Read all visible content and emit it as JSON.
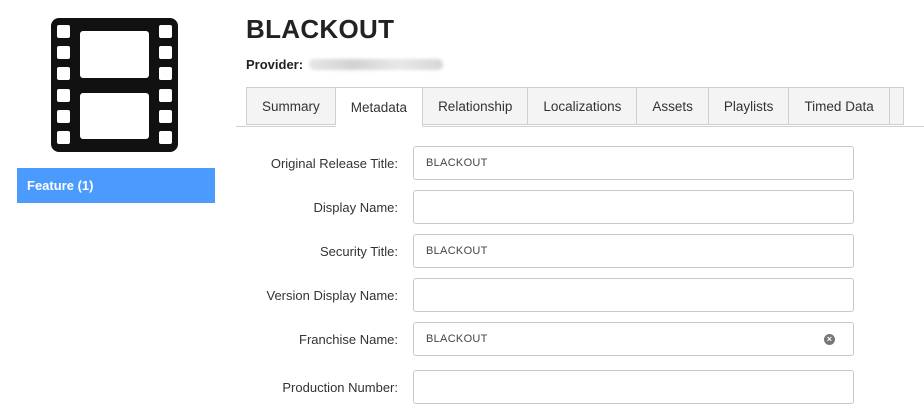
{
  "sidebar": {
    "items": [
      {
        "label": "Feature (1)"
      }
    ]
  },
  "header": {
    "title": "BLACKOUT",
    "provider_label": "Provider:"
  },
  "tabs": [
    {
      "label": "Summary",
      "active": false
    },
    {
      "label": "Metadata",
      "active": true
    },
    {
      "label": "Relationship",
      "active": false
    },
    {
      "label": "Localizations",
      "active": false
    },
    {
      "label": "Assets",
      "active": false
    },
    {
      "label": "Playlists",
      "active": false
    },
    {
      "label": "Timed Data",
      "active": false
    }
  ],
  "form": {
    "fields": [
      {
        "label": "Original Release Title:",
        "value": "BLACKOUT"
      },
      {
        "label": "Display Name:",
        "value": ""
      },
      {
        "label": "Security Title:",
        "value": "BLACKOUT"
      },
      {
        "label": "Version Display Name:",
        "value": ""
      },
      {
        "label": "Franchise Name:",
        "value": "BLACKOUT",
        "clearable": true
      },
      {
        "label": "Production Number:",
        "value": ""
      }
    ]
  },
  "icons": {
    "media": "film-strip-icon",
    "clear": "clear-circle-icon"
  },
  "colors": {
    "accent": "#4b9bff",
    "title": "#222222",
    "icon": "#111111"
  }
}
